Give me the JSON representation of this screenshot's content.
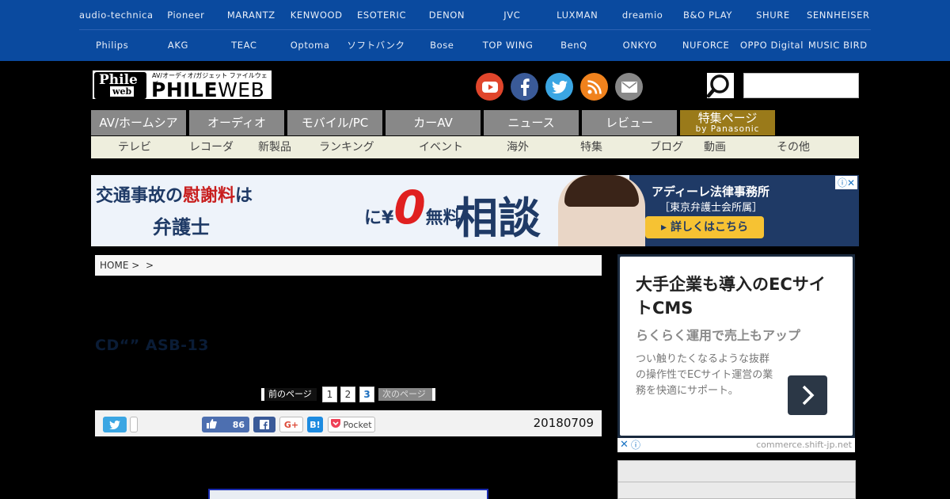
{
  "brands": {
    "row1": [
      "audio-technica",
      "Pioneer",
      "MARANTZ",
      "KENWOOD",
      "ESOTERIC",
      "DENON",
      "JVC",
      "LUXMAN",
      "dreamio",
      "B&O PLAY",
      "SHURE",
      "SENNHEISER"
    ],
    "row2": [
      "Philips",
      "AKG",
      "TEAC",
      "Optoma",
      "ソフトバンク",
      "Bose",
      "TOP WING",
      "BenQ",
      "ONKYO",
      "NUFORCE",
      "OPPO Digital",
      "MUSIC BIRD"
    ]
  },
  "logo": {
    "phile": "Phile",
    "web": "web",
    "tagline": "AV/オーディオ/ガジェット ファイルウェブ",
    "wordmark_bold": "PHILE",
    "wordmark_thin": "WEB"
  },
  "social": {
    "youtube_color": "#e0452b",
    "facebook_color": "#3a5a98",
    "twitter_color": "#3ba6e3",
    "rss_color": "#f0821d",
    "mail_color": "#888888"
  },
  "search": {
    "placeholder": ""
  },
  "main_nav": {
    "tabs": [
      "AV/ホームシア",
      "オーディオ",
      "モバイル/PC",
      "カーAV",
      "ニュース",
      "レビュー"
    ],
    "special_tab": {
      "label": "特集ページ",
      "sub": "by Panasonic"
    }
  },
  "sub_nav": [
    "テレビ",
    "レコーダ",
    "新製品",
    "ランキング",
    "イベント",
    "海外",
    "特集",
    "ブログ",
    "動画",
    "その他"
  ],
  "top_ad": {
    "line1_a": "交通事故の",
    "line1_b": "慰謝料",
    "line1_c": "は",
    "line2": "弁護士",
    "zero_prefix": "に¥",
    "zero": "0",
    "free": "無料",
    "consult": "相談",
    "firm": "アディーレ法律事務所",
    "dept": "［東京弁護士会所属］",
    "cta": "▸ 詳しくはこちら",
    "adchoice": "ⓘ✕"
  },
  "breadcrumb": {
    "home": "HOME",
    "sep1": ">",
    "sep2": ">"
  },
  "article": {
    "title": "CD“” ASB-13",
    "date": "20180709"
  },
  "pager": {
    "prev": "前のページ",
    "pages": [
      "1",
      "2",
      "3"
    ],
    "current": "3",
    "next": "次のページ"
  },
  "share": {
    "like_count": "86",
    "pocket": "Pocket",
    "gplus": "G+",
    "hatena": "B!"
  },
  "side_ad": {
    "headline": "大手企業も導入のECサイトCMS",
    "subhead": "らくらく運用で売上もアップ",
    "body": "つい触りたくなるような抜群の操作性でECサイト運営の業務を快適にサポート。",
    "domain": "commerce.shift-jp.net",
    "close": "✕",
    "info": "ⓘ"
  }
}
